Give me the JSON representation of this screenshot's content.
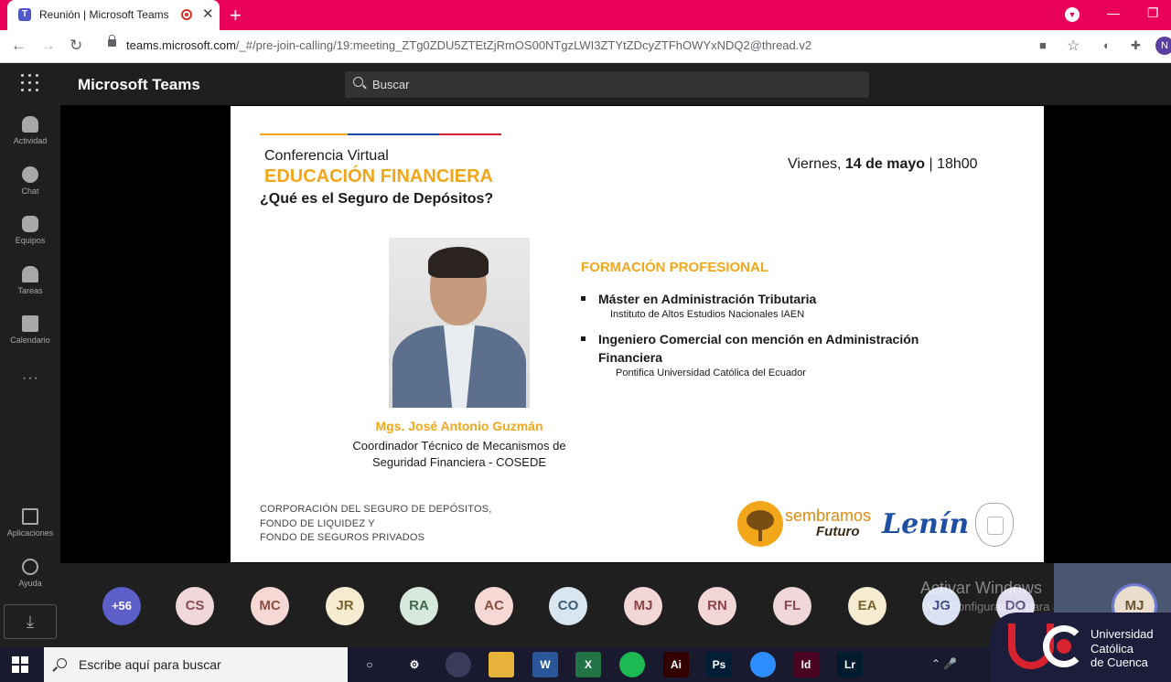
{
  "browser": {
    "tab_title": "Reunión | Microsoft Teams",
    "new_tab": "+",
    "url_host": "teams.microsoft.com",
    "url_path": "/_#/pre-join-calling/19:meeting_ZTg0ZDU5ZTEtZjRmOS00NTgzLWI3ZTYtZDcyZTFhOWYxNDQ2@thread.v2",
    "profile_initial": "N",
    "colors": {
      "tabstrip": "#e8005a"
    }
  },
  "teams": {
    "title": "Microsoft Teams",
    "search_placeholder": "Buscar",
    "rail": [
      {
        "label": "Actividad",
        "icon": "bell-icon"
      },
      {
        "label": "Chat",
        "icon": "chat-icon"
      },
      {
        "label": "Equipos",
        "icon": "teams-icon"
      },
      {
        "label": "Tareas",
        "icon": "tasks-icon"
      },
      {
        "label": "Calendario",
        "icon": "calendar-icon"
      }
    ],
    "rail_more": "···",
    "rail_bottom": [
      {
        "label": "Aplicaciones",
        "icon": "apps-icon"
      },
      {
        "label": "Ayuda",
        "icon": "help-icon"
      }
    ]
  },
  "slide": {
    "conference": "Conferencia Virtual",
    "title": "EDUCACIÓN FINANCIERA",
    "question": "¿Qué es el Seguro de Depósitos?",
    "date_prefix": "Viernes, ",
    "date_bold": "14 de mayo",
    "date_suffix": " | 18h00",
    "speaker_name": "Mgs. José Antonio Guzmán",
    "speaker_role_1": "Coordinador Técnico de Mecanismos de",
    "speaker_role_2": "Seguridad Financiera - COSEDE",
    "formation_heading": "FORMACIÓN PROFESIONAL",
    "degree_1": "Máster en Administración Tributaria",
    "inst_1": "Instituto de Altos Estudios Nacionales IAEN",
    "degree_2a": "Ingeniero Comercial con mención en Administración",
    "degree_2b": "Financiera",
    "inst_2": "Pontifica Universidad Católica del Ecuador",
    "corp_1": "CORPORACIÓN DEL SEGURO DE DEPÓSITOS,",
    "corp_2": "FONDO DE LIQUIDEZ Y",
    "corp_3": "FONDO DE SEGUROS PRIVADOS",
    "logo_sembramos": "sembramos",
    "logo_futuro": "Futuro",
    "logo_lenin": "Lenín",
    "colors": {
      "accent": "#f2a71b",
      "stripe": [
        "#f2a71b",
        "#1f4fa3",
        "#d7232f"
      ]
    }
  },
  "participants": {
    "overflow": "+56",
    "items": [
      {
        "initials": "CS",
        "bg": "#f0d7d9",
        "fg": "#8a4b53"
      },
      {
        "initials": "MC",
        "bg": "#f6d9d4",
        "fg": "#8d4d43"
      },
      {
        "initials": "JR",
        "bg": "#f6ecd2",
        "fg": "#7a6431"
      },
      {
        "initials": "RA",
        "bg": "#d7e8dc",
        "fg": "#3f6a4b"
      },
      {
        "initials": "AC",
        "bg": "#f6d9d4",
        "fg": "#8d4d43"
      },
      {
        "initials": "CO",
        "bg": "#d9e6ef",
        "fg": "#3c5c78"
      },
      {
        "initials": "MJ",
        "bg": "#f3d6d6",
        "fg": "#8a4545"
      },
      {
        "initials": "RN",
        "bg": "#f3d6d6",
        "fg": "#8a4545"
      },
      {
        "initials": "FL",
        "bg": "#f0d7d9",
        "fg": "#8a4b53"
      },
      {
        "initials": "EA",
        "bg": "#f6ecd2",
        "fg": "#7a6431"
      },
      {
        "initials": "JG",
        "bg": "#d9e1f2",
        "fg": "#3c4e82"
      },
      {
        "initials": "DO",
        "bg": "#e2dcef",
        "fg": "#5a4d82"
      }
    ],
    "self_initials": "MJ",
    "watermark_1": "Activar Windows",
    "watermark_2": "Ve a Configuración para activar Windows."
  },
  "taskbar": {
    "search_placeholder": "Escribe aquí para buscar",
    "apps": [
      {
        "name": "cortana-icon",
        "label": "○",
        "bg": "transparent"
      },
      {
        "name": "settings-icon",
        "label": "⚙",
        "bg": "transparent"
      },
      {
        "name": "chrome-icon",
        "label": "",
        "bg": "#3a3a5a"
      },
      {
        "name": "explorer-icon",
        "label": "",
        "bg": "#e8b33a"
      },
      {
        "name": "word-icon",
        "label": "W",
        "bg": "#2b579a"
      },
      {
        "name": "excel-icon",
        "label": "X",
        "bg": "#217346"
      },
      {
        "name": "spotify-icon",
        "label": "",
        "bg": "#1db954"
      },
      {
        "name": "illustrator-icon",
        "label": "Ai",
        "bg": "#330000"
      },
      {
        "name": "photoshop-icon",
        "label": "Ps",
        "bg": "#001e36"
      },
      {
        "name": "zoom-icon",
        "label": "",
        "bg": "#2d8cff"
      },
      {
        "name": "indesign-icon",
        "label": "Id",
        "bg": "#49021f"
      },
      {
        "name": "lightroom-icon",
        "label": "Lr",
        "bg": "#001a2e"
      }
    ]
  },
  "university": {
    "line1": "Universidad",
    "line2": "Católica",
    "line3": "de Cuenca"
  }
}
